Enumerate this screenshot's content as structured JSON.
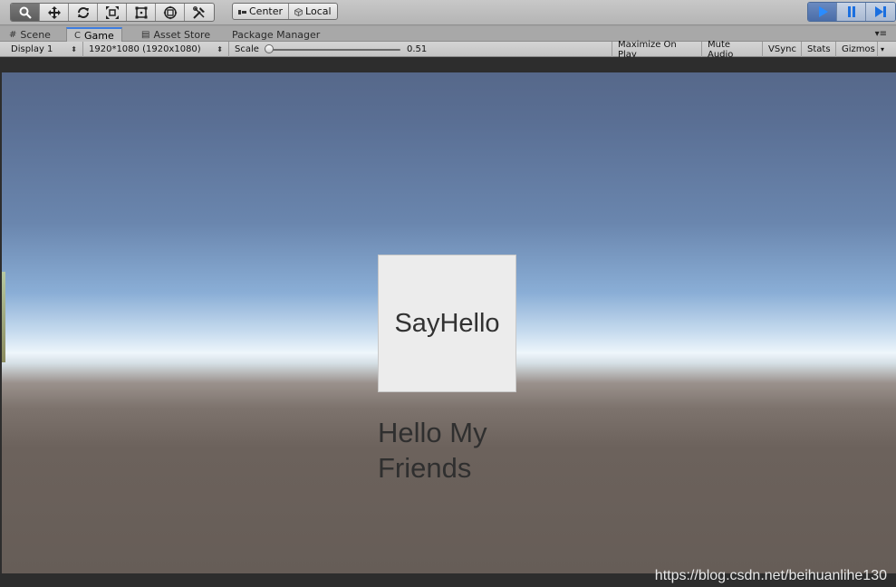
{
  "toolbar": {
    "tools": [
      "hand-tool",
      "move-tool",
      "rotate-tool",
      "scale-tool",
      "rect-tool",
      "transform-tool",
      "custom-tool"
    ],
    "pivot_label": "Center",
    "space_label": "Local"
  },
  "tabs": [
    {
      "label": "Scene",
      "icon": "#"
    },
    {
      "label": "Game",
      "icon": "C"
    },
    {
      "label": "Asset Store",
      "icon": "▤"
    },
    {
      "label": "Package Manager",
      "icon": ""
    }
  ],
  "tab_menu": "▾≡",
  "gamebar": {
    "display": "Display 1",
    "resolution": "1920*1080 (1920x1080)",
    "scale_label": "Scale",
    "scale_value": "0.51",
    "scale_fraction": 0.05,
    "maximize": "Maximize On Play",
    "mute": "Mute Audio",
    "vsync": "VSync",
    "stats": "Stats",
    "gizmos": "Gizmos"
  },
  "game": {
    "button_label": "SayHello",
    "text_line1": "Hello My",
    "text_line2": "Friends"
  },
  "watermark": "https://blog.csdn.net/beihuanlihe130",
  "colors": {
    "play_active": "#4a6da8",
    "tab_accent": "#3e7de0",
    "sky_top": "#56688a",
    "ground": "#665d57"
  }
}
